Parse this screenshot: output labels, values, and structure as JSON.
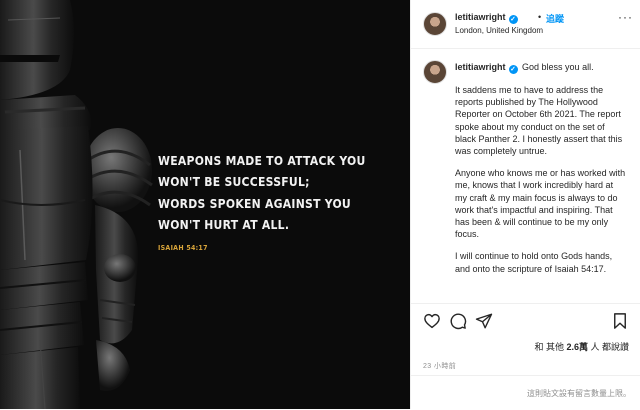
{
  "post": {
    "quote_lines": [
      "WEAPONS MADE TO ATTACK YOU",
      "WON'T BE SUCCESSFUL;",
      "WORDS SPOKEN AGAINST YOU",
      "WON'T HURT AT ALL."
    ],
    "quote_reference": "ISAIAH 54:17"
  },
  "header": {
    "username": "letitiawright",
    "verified_mark": "✓",
    "separator": "•",
    "follow_label": "追蹤",
    "location": "London, United Kingdom",
    "more_label": "···"
  },
  "caption": {
    "username": "letitiawright",
    "first_line": "God bless you all.",
    "paragraphs": [
      "It saddens me to have to address the reports published by The Hollywood Reporter on October 6th 2021. The report spoke about my conduct on the set of black Panther 2. I honestly assert that this was completely untrue.",
      "Anyone who knows me or has worked with me, knows that I work incredibly hard at my craft & my main focus is always to do work that's impactful and inspiring. That has been & will continue to be my only focus.",
      "I will continue to hold onto Gods hands, and onto the scripture of Isaiah 54:17."
    ]
  },
  "actions": {
    "icons": [
      "heart-icon",
      "comment-icon",
      "share-icon",
      "bookmark-icon"
    ]
  },
  "likes": {
    "prefix": "和 其他 ",
    "count": "2.6萬",
    "suffix": " 人 都說讚"
  },
  "timestamp": "23 小時前",
  "comments_limited": "這則貼文設有留言數量上限。",
  "colors": {
    "accent": "#0095f6",
    "quote_reference": "#d9a53a",
    "media_bg": "#0b0b0b"
  }
}
